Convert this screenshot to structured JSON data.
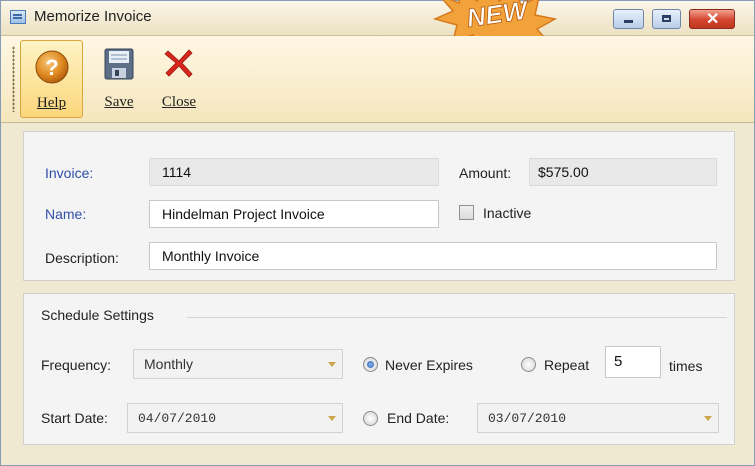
{
  "window": {
    "title": "Memorize Invoice",
    "badge_text": "NEW",
    "controls": {
      "minimize": "minimize",
      "maximize": "maximize",
      "close": "✕"
    }
  },
  "toolbar": {
    "help_label": "Help",
    "save_label": "Save",
    "close_label": "Close"
  },
  "details": {
    "invoice_label": "Invoice:",
    "invoice_value": "1114",
    "amount_label": "Amount:",
    "amount_value": "$575.00",
    "name_label": "Name:",
    "name_value": "Hindelman Project Invoice",
    "inactive_label": "Inactive",
    "inactive_checked": false,
    "description_label": "Description:",
    "description_value": "Monthly Invoice"
  },
  "schedule": {
    "group_label": "Schedule Settings",
    "frequency_label": "Frequency:",
    "frequency_value": "Monthly",
    "never_expires_label": "Never Expires",
    "never_expires_selected": true,
    "repeat_label": "Repeat",
    "repeat_value": "5",
    "times_label": "times",
    "start_date_label": "Start Date:",
    "start_date_value": "04/07/2010",
    "end_date_label": "End Date:",
    "end_date_value": "03/07/2010"
  },
  "colors": {
    "link_label": "#3050a8",
    "toolbar_bg": "#f4e6bd",
    "help_active_bg": "#fbd77c",
    "badge_fill": "#f2a23a"
  },
  "icons": {
    "help": "question-circle-icon",
    "save": "floppy-disk-icon",
    "close": "red-x-icon"
  }
}
